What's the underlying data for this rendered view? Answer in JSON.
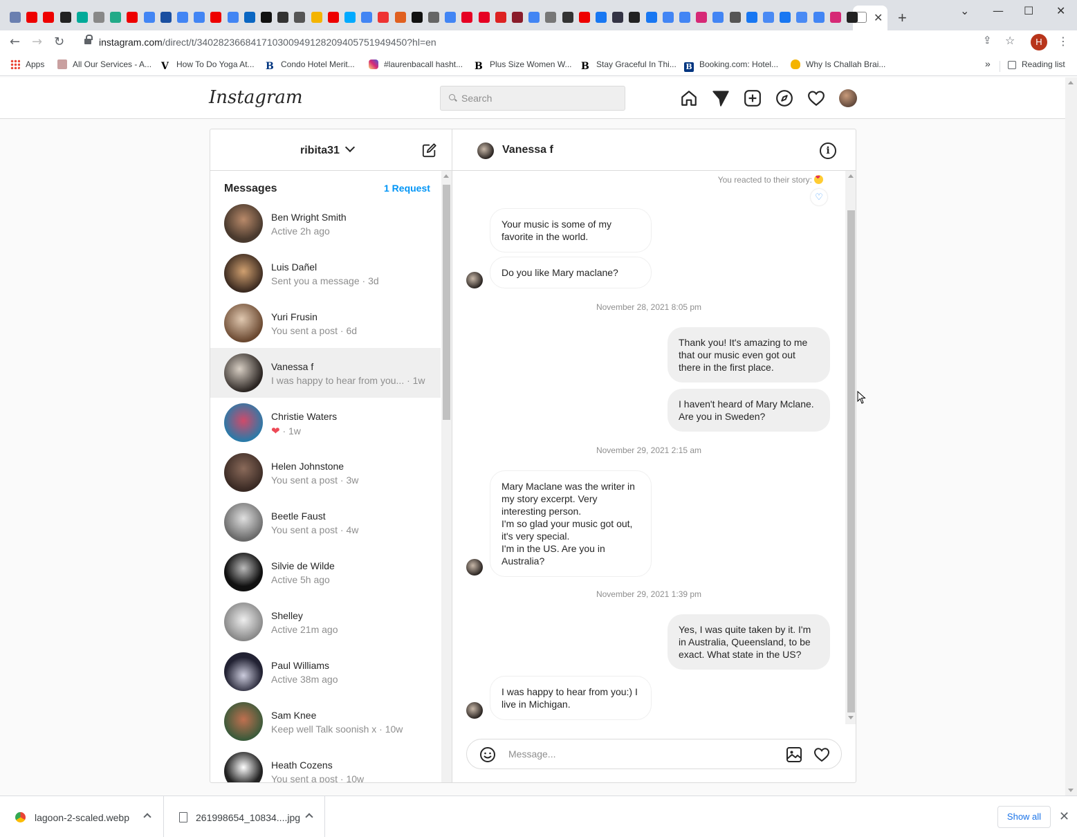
{
  "browser": {
    "url_main": "instagram.com",
    "url_path": "/direct/t/340282366841710300949128209405751949450?hl=en",
    "profile_initial": "H",
    "tab_close": "✕",
    "new_tab": "+",
    "bookmarks": [
      {
        "label": "Apps",
        "icon": "apps-grid-icon",
        "color": "#e8453c"
      },
      {
        "label": "All Our Services - A...",
        "icon": "services-icon",
        "color": "#a0a0a0"
      },
      {
        "label": "How To Do Yoga At...",
        "icon": "v-logo-icon",
        "color": "#000000"
      },
      {
        "label": "Condo Hotel Merit...",
        "icon": "b-logo-icon",
        "color": "#003580"
      },
      {
        "label": "#laurenbacall hasht...",
        "icon": "instagram-icon",
        "color": "#d62976"
      },
      {
        "label": "Plus Size Women W...",
        "icon": "b-logo-icon",
        "color": "#000000"
      },
      {
        "label": "Stay Graceful In Thi...",
        "icon": "b-logo-icon",
        "color": "#000000"
      },
      {
        "label": "Booking.com: Hotel...",
        "icon": "booking-icon",
        "color": "#003580"
      },
      {
        "label": "Why Is Challah Brai...",
        "icon": "challah-icon",
        "color": "#f4b400"
      }
    ],
    "reading_list": "Reading list",
    "downloads": [
      {
        "filename": "lagoon-2-scaled.webp"
      },
      {
        "filename": "261998654_10834....jpg"
      }
    ],
    "show_all": "Show all"
  },
  "instagram": {
    "logo": "Instagram",
    "search_placeholder": "Search",
    "account": "ribita31",
    "messages_title": "Messages",
    "requests": "1 Request",
    "conversations": [
      {
        "name": "Ben Wright Smith",
        "sub": "Active 2h ago"
      },
      {
        "name": "Luis Dañel",
        "sub": "Sent you a message · 3d"
      },
      {
        "name": "Yuri Frusin",
        "sub": "You sent a post · 6d"
      },
      {
        "name": "Vanessa f",
        "sub": "I was happy to hear from you... · 1w"
      },
      {
        "name": "Christie Waters",
        "sub": "❤ · 1w"
      },
      {
        "name": "Helen Johnstone",
        "sub": "You sent a post · 3w"
      },
      {
        "name": "Beetle Faust",
        "sub": "You sent a post · 4w"
      },
      {
        "name": "Silvie de Wilde",
        "sub": "Active 5h ago"
      },
      {
        "name": "Shelley",
        "sub": "Active 21m ago"
      },
      {
        "name": "Paul Williams",
        "sub": "Active 38m ago"
      },
      {
        "name": "Sam Knee",
        "sub": "Keep well Talk soonish x · 10w"
      },
      {
        "name": "Heath Cozens",
        "sub": "You sent a post · 10w"
      }
    ],
    "chat": {
      "peer_name": "Vanessa f",
      "reacted_text": "You reacted to their story:",
      "messages": [
        {
          "dir": "in",
          "text": "Your music is some of my favorite in the world."
        },
        {
          "dir": "in",
          "text": "Do you like Mary maclane?"
        },
        {
          "dir": "stamp",
          "text": "November 28, 2021 8:05 pm"
        },
        {
          "dir": "out",
          "text": "Thank you! It's amazing to me that our music even got out there in the first place."
        },
        {
          "dir": "out",
          "text": "I haven't heard of Mary Mclane. Are you in Sweden?"
        },
        {
          "dir": "stamp",
          "text": "November 29, 2021 2:15 am"
        },
        {
          "dir": "in",
          "text": "Mary Maclane was the writer in my story excerpt. Very interesting person.\nI'm so glad your music got out, it's very special.\nI'm in the US. Are you in Australia?"
        },
        {
          "dir": "stamp",
          "text": "November 29, 2021 1:39 pm"
        },
        {
          "dir": "out",
          "text": "Yes, I was quite taken by it. I'm in Australia, Queensland, to be exact. What state in the US?"
        },
        {
          "dir": "in",
          "text": "I was happy to hear from you:) I live in Michigan."
        }
      ],
      "message_placeholder": "Message..."
    }
  }
}
